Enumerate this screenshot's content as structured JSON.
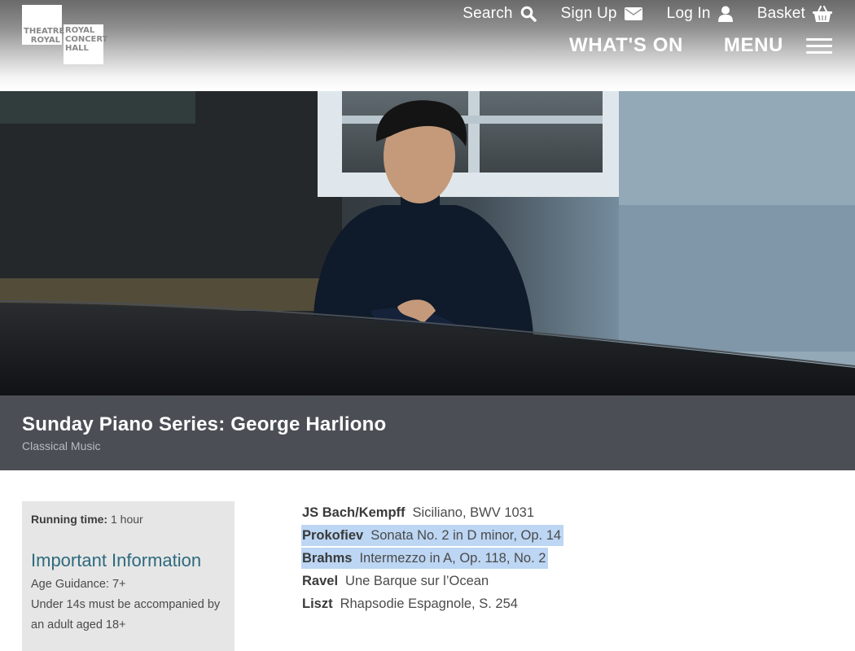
{
  "logo": {
    "left_text": "THEATRE\nROYAL",
    "right_text": "ROYAL\nCONCERT\nHALL"
  },
  "util_nav": [
    {
      "label": "Search",
      "icon": "search-icon"
    },
    {
      "label": "Sign Up",
      "icon": "envelope-icon"
    },
    {
      "label": "Log In",
      "icon": "user-icon"
    },
    {
      "label": "Basket",
      "icon": "basket-icon"
    }
  ],
  "main_nav": {
    "whats_on": "WHAT'S ON",
    "menu": "MENU"
  },
  "event": {
    "title": "Sunday Piano Series: George Harliono",
    "genre": "Classical Music"
  },
  "info": {
    "running_label": "Running time:",
    "running_value": "1 hour",
    "important_title": "Important Information",
    "lines": [
      "Age Guidance: 7+",
      "Under 14s must be accompanied by",
      "an adult aged 18+"
    ]
  },
  "programme": [
    {
      "composer": "JS Bach/Kempff",
      "piece": "Siciliano, BWV 1031",
      "highlighted": false
    },
    {
      "composer": "Prokofiev",
      "piece": "Sonata No. 2 in D minor, Op. 14",
      "highlighted": true
    },
    {
      "composer": "Brahms",
      "piece": "Intermezzo in A, Op. 118, No. 2",
      "highlighted": true
    },
    {
      "composer": "Ravel",
      "piece": "Une Barque sur l’Ocean",
      "highlighted": false
    },
    {
      "composer": "Liszt",
      "piece": "Rhapsodie Espagnole, S. 254",
      "highlighted": false
    }
  ],
  "colors": {
    "title_bar": "#4b4f55",
    "info_box": "#e6e6e6",
    "heading_teal": "#2d6a7d",
    "selection": "#bcd6f3"
  }
}
